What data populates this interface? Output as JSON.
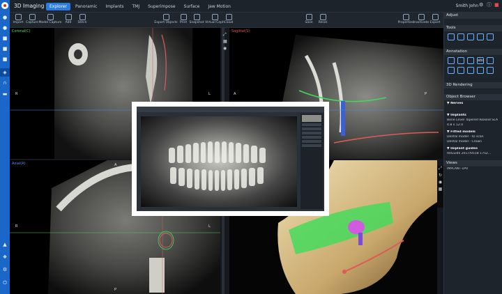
{
  "app": {
    "title": "3D Imaging",
    "user": "Smith John"
  },
  "tabs": [
    {
      "label": "Explorer",
      "active": true
    },
    {
      "label": "Panoramic",
      "active": false
    },
    {
      "label": "Implants",
      "active": false
    },
    {
      "label": "TMJ",
      "active": false
    },
    {
      "label": "Superimpose",
      "active": false
    },
    {
      "label": "Surface",
      "active": false
    },
    {
      "label": "Jaw Motion",
      "active": false
    }
  ],
  "toolbar": {
    "left": [
      "Import",
      "Capture",
      "Model Capture",
      "Add",
      "Stitch"
    ],
    "middle": [
      "Export Objects",
      "Print",
      "Snapshot",
      "Virtual Ceph",
      "Cloud"
    ],
    "save": [
      "Save",
      "Reset"
    ],
    "right": [
      "Properties",
      "Inactivate",
      "Export"
    ]
  },
  "viewports": {
    "coronal": {
      "label": "Coronal(C)",
      "left": "R",
      "right": "L"
    },
    "sagittal": {
      "label": "Sagittal(S)",
      "left": "A",
      "right": "P"
    },
    "axial": {
      "label": "Axial(A)",
      "left": "R",
      "right": "L",
      "top": "A",
      "bottom": "P"
    }
  },
  "panel": {
    "sections": [
      "Adjust",
      "Tools",
      "Annotation",
      "3D Rendering",
      "Object Browser",
      "Views"
    ],
    "annotation_abc": "abc",
    "objects": {
      "nerves": "Nerves",
      "implants": "Implants",
      "implant_item": "Bone Level Tapered Roxolid SLA",
      "implant_size": "4.8 x 12.0",
      "fitted_models": "Fitted models",
      "model_1": "Dental model - IO scan",
      "model_2": "Dental model - Crown",
      "implant_guides": "Implant guides",
      "guide_item": "ReGuide 2017/0518 1752...",
      "implant_view": "IMPLANT-1P0"
    }
  },
  "colors": {
    "accent": "#2c7be5",
    "rail": "#1b66c9",
    "nerve": "#e05a5a",
    "model": "#3ddc5a",
    "implant": "#d05be0"
  }
}
